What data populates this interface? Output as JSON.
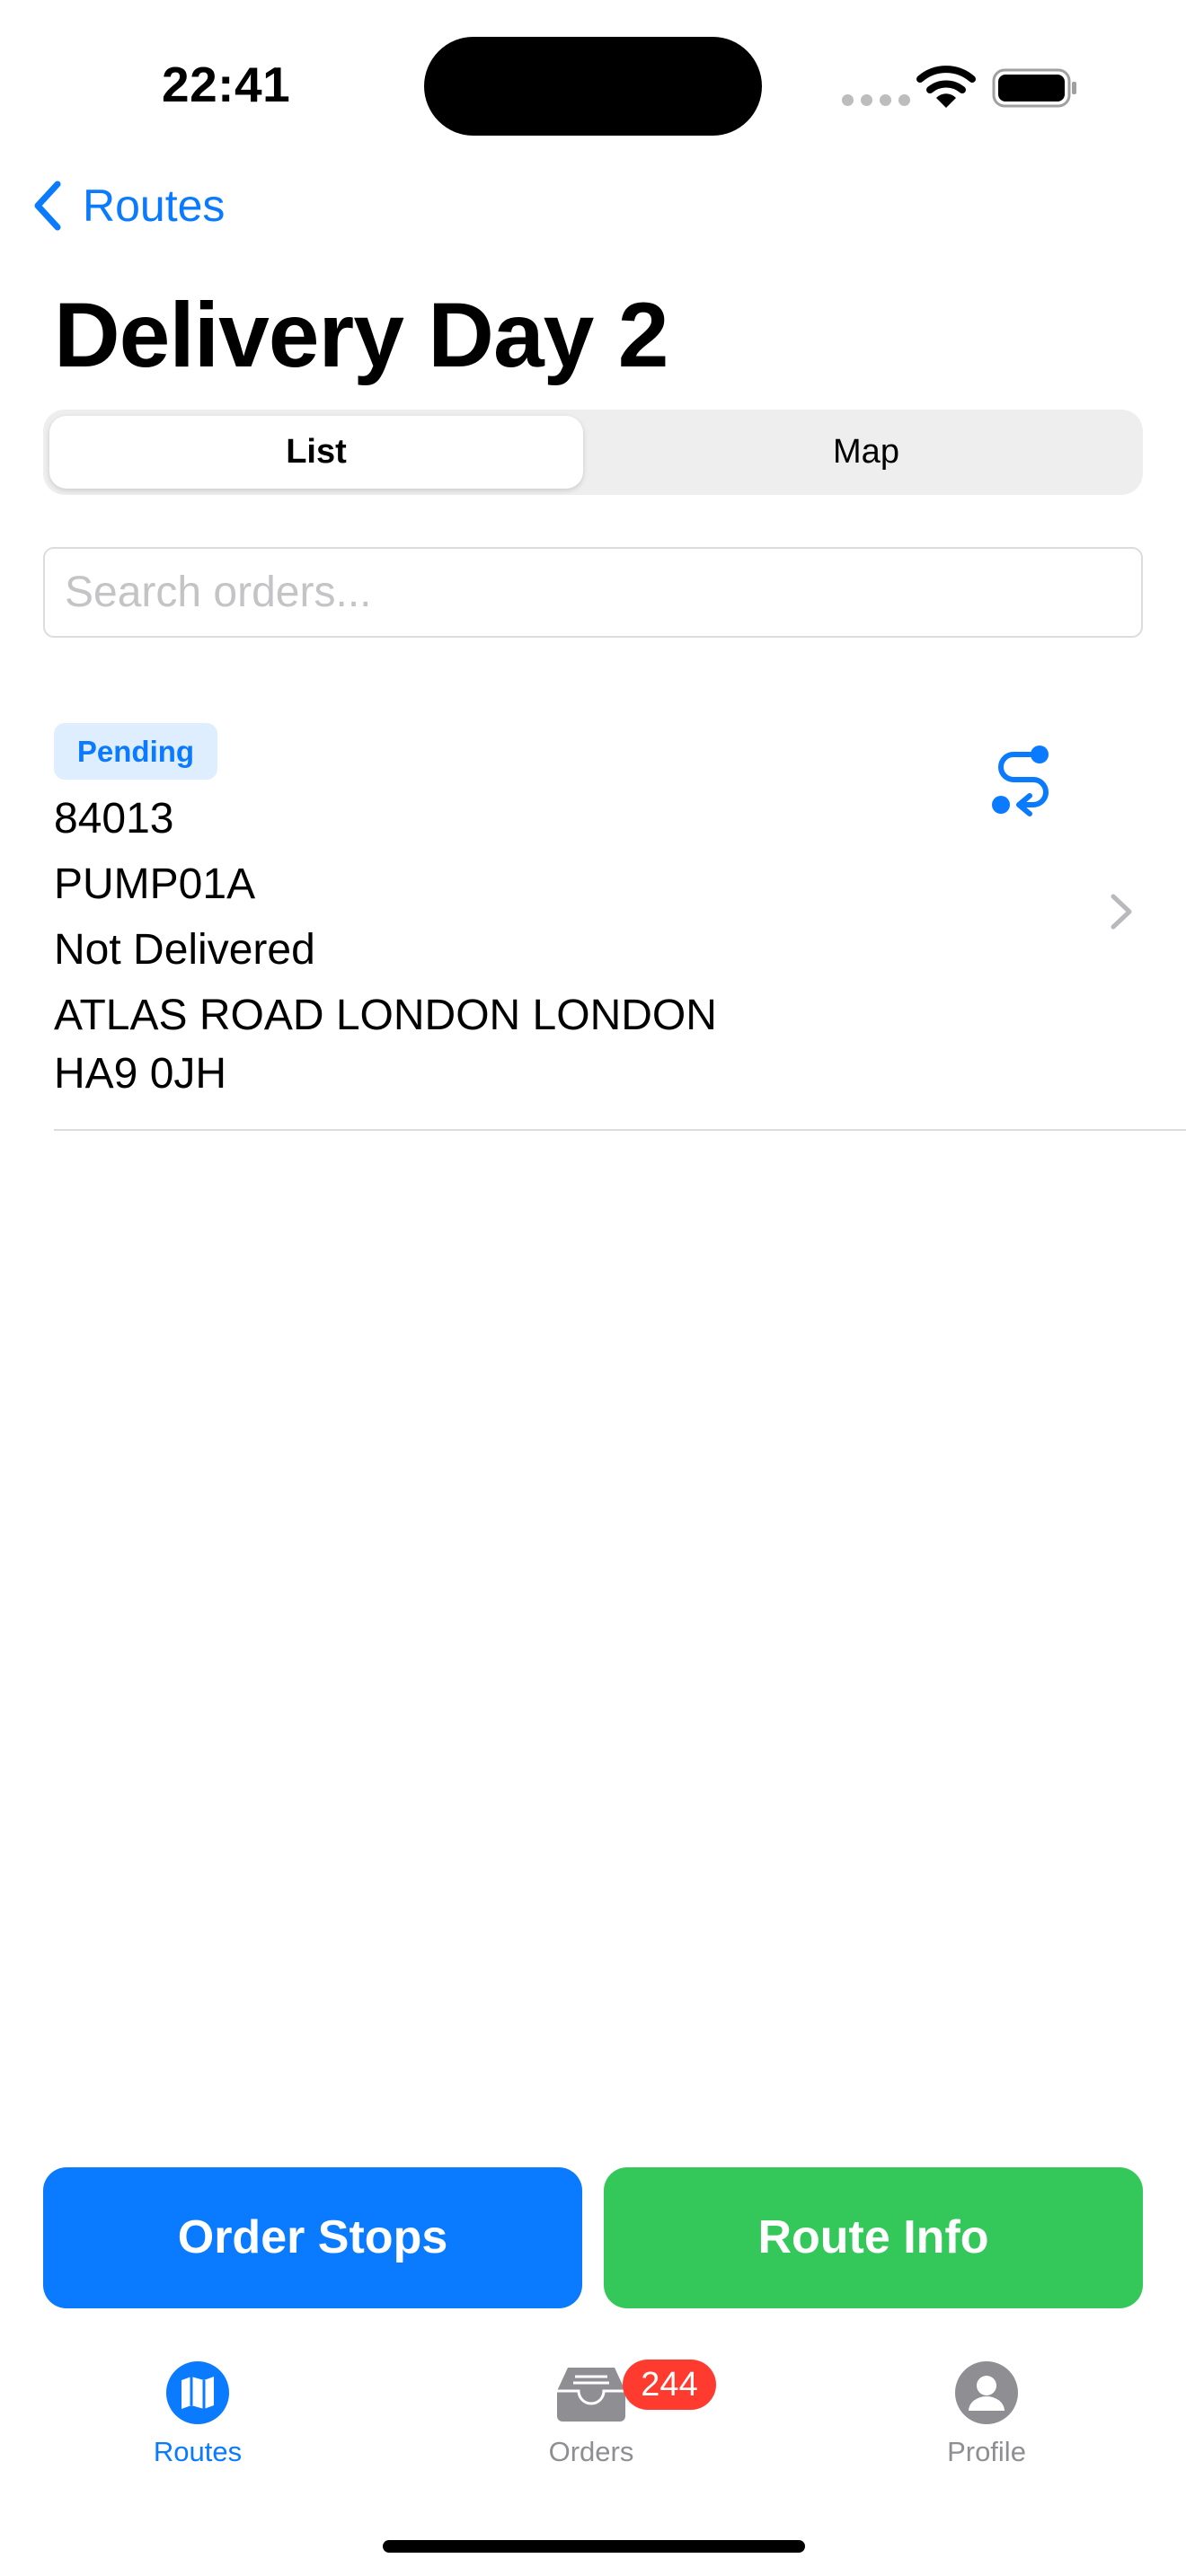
{
  "status_bar": {
    "time": "22:41"
  },
  "nav": {
    "back_label": "Routes",
    "title": "Delivery Day 2"
  },
  "segmented": {
    "options": [
      "List",
      "Map"
    ],
    "selected": "List"
  },
  "search": {
    "placeholder": "Search orders...",
    "value": ""
  },
  "orders": [
    {
      "status": "Pending",
      "number": "84013",
      "code": "PUMP01A",
      "delivery_status": "Not Delivered",
      "address_line1": "ATLAS ROAD LONDON LONDON",
      "address_line2": "HA9 0JH"
    }
  ],
  "actions": {
    "order_stops": "Order Stops",
    "route_info": "Route Info"
  },
  "tabs": [
    {
      "label": "Routes",
      "icon": "map-icon",
      "active": true
    },
    {
      "label": "Orders",
      "icon": "tray-icon",
      "badge": "244"
    },
    {
      "label": "Profile",
      "icon": "person-circle-icon"
    }
  ],
  "colors": {
    "accent": "#0a7aff",
    "success": "#34c759",
    "badge": "#ff3b30",
    "pending_bg": "#dfeefe"
  }
}
